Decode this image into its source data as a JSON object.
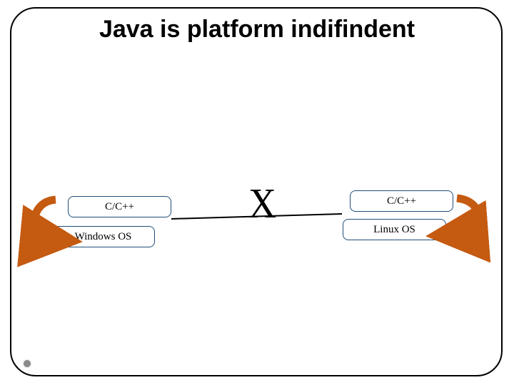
{
  "title": "Java is platform indifindent",
  "left": {
    "lang": "C/C++",
    "os": "Windows OS"
  },
  "right": {
    "lang": "C/C++",
    "os": "Linux OS"
  },
  "cross": "X",
  "arrow_color": "#c55a11"
}
